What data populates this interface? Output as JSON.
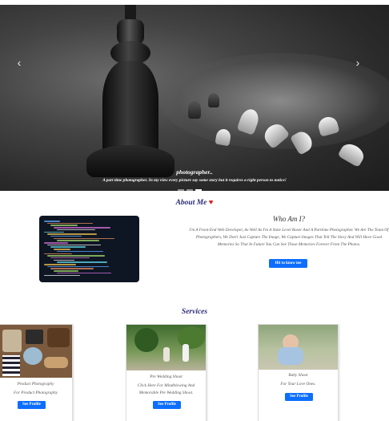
{
  "hero": {
    "prev_glyph": "‹",
    "next_glyph": "›",
    "title": "photographer..",
    "text": "A part time photographer. In my view every picture say some story but it requires a right person to notice!",
    "slide_count": 3,
    "active_slide": 2
  },
  "about": {
    "heading": "About Me",
    "heart_icon": "♥",
    "title": "Who Am I?",
    "body": "I'm A Front-End Web Developer, As Well As I'm A State Level Boxer And A Parttime Photographer. We Are The Team Of Photographers, We Don't Just Capture The Image, We Capture Images That Tell The Story And Will Have Good Memories So That In Future You Can See Those Memories Forever From The Photos.",
    "button": "Hit to know me"
  },
  "services": {
    "heading": "Services",
    "cards": [
      {
        "title": "Product Photography",
        "text": "For Product Photography",
        "button": "See Profile"
      },
      {
        "title": "Pre Wedding Shoot",
        "text": "Click Here For Mindblowing And Memorable Pre Wedding Shoot.",
        "button": "See Profile"
      },
      {
        "title": "Baby Shoot",
        "text": "For Your Love Ones.",
        "button": "See Profile"
      }
    ]
  },
  "colors": {
    "accent": "#0d6efd",
    "heading": "#2a2a78",
    "heart": "#e01b1b"
  }
}
